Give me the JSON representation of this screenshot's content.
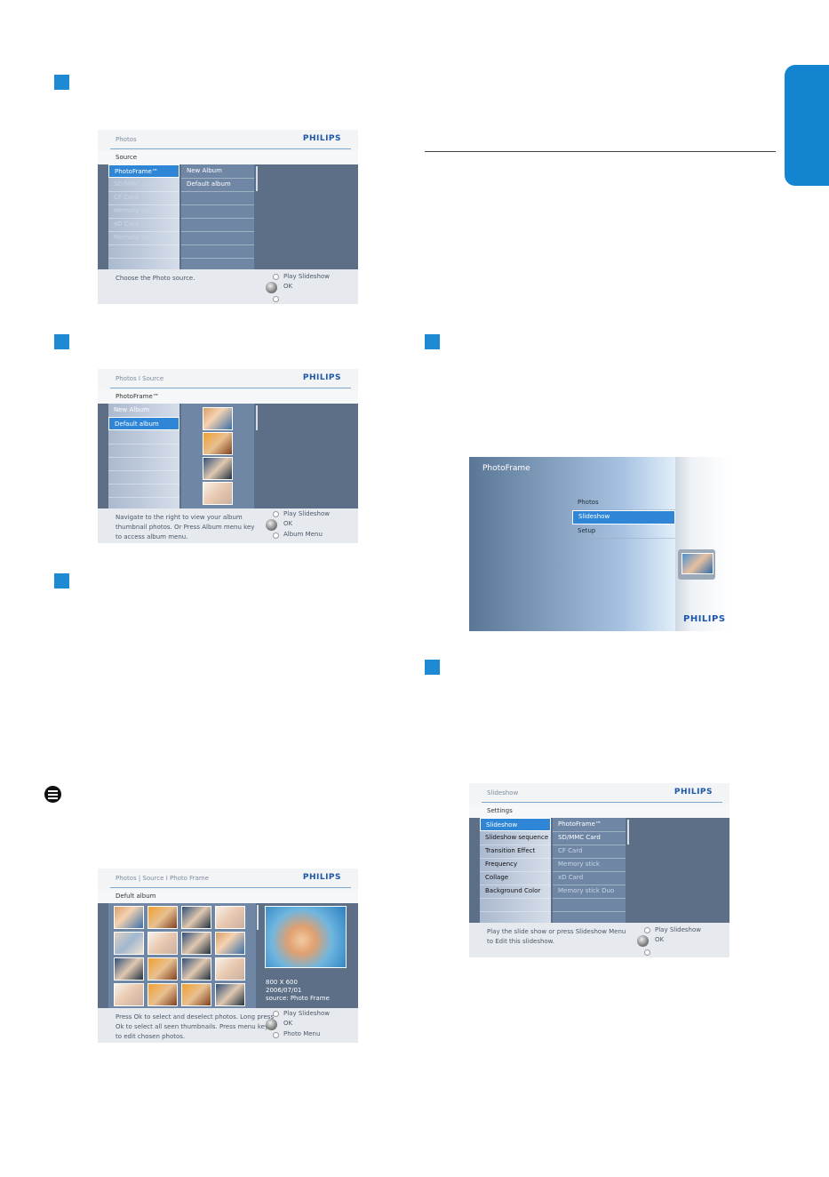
{
  "brand": "PHILIPS",
  "colors": {
    "accent": "#1f8ad4",
    "header_rule": "#7da9cf"
  },
  "screen1": {
    "breadcrumb": "Photos",
    "subheader": "Source",
    "left_items": [
      "PhotoFrame™",
      "SD/MMC card",
      "CF Card",
      "Memory Stick",
      "xD Card",
      "Memory Stick Duo"
    ],
    "selected_index": 0,
    "mid_items": [
      "New Album",
      "Default album"
    ],
    "footer_msg": "Choose the Photo source.",
    "footer_actions": [
      "Play Slideshow",
      "OK"
    ]
  },
  "screen2": {
    "breadcrumb": "Photos I Source",
    "subheader": "PhotoFrame™",
    "left_items": [
      "New Album",
      "Default album"
    ],
    "selected_index": 1,
    "footer_msg": "Navigate to the right to view your album thumbnail photos. Or Press Album menu key to access album menu.",
    "footer_actions": [
      "Play Slideshow",
      "OK",
      "Album Menu"
    ]
  },
  "screen3": {
    "breadcrumb": "Photos | Source I Photo Frame",
    "subheader": "Defult album",
    "resolution": "800 X 600",
    "date": "2006/07/01",
    "source": "source: Photo Frame",
    "footer_msg": "Press Ok to select and deselect photos. Long press Ok to select all seen thumbnails. Press menu key to edit chosen photos.",
    "footer_actions": [
      "Play Slideshow",
      "OK",
      "Photo Menu"
    ]
  },
  "screen4": {
    "title": "PhotoFrame",
    "menu": [
      "Photos",
      "Slideshow",
      "Setup"
    ],
    "selected_index": 1
  },
  "screen5": {
    "breadcrumb": "Slideshow",
    "subheader": "Settings",
    "left_items": [
      "Slideshow",
      "Slideshow sequence",
      "Transition Effect",
      "Frequency",
      "Collage",
      "Background Color"
    ],
    "selected_index": 0,
    "mid_items": [
      "PhotoFrame™",
      "SD/MMC Card",
      "CF Card",
      "Memory stick",
      "xD Card",
      "Memory stick Duo"
    ],
    "footer_msg": "Play the slide show or press Slideshow Menu to Edit this slideshow.",
    "footer_actions": [
      "Play Slideshow",
      "OK"
    ]
  }
}
